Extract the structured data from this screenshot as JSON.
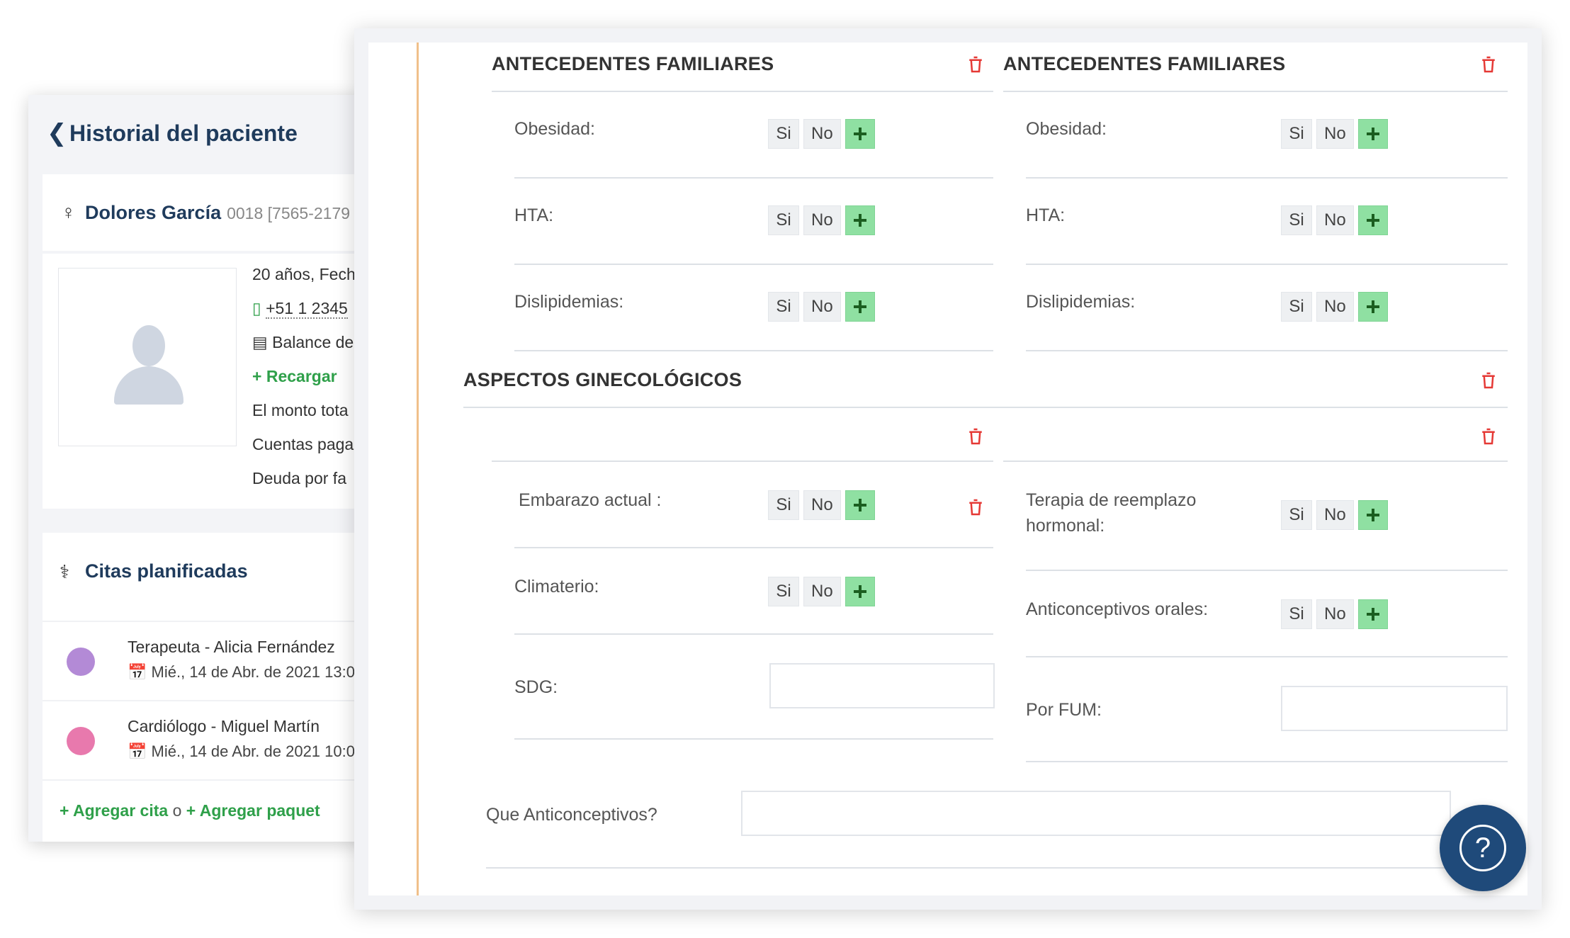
{
  "history": {
    "back_icon": "chevron-left-icon",
    "title": "Historial del paciente",
    "patient_name": "Dolores García",
    "patient_id": "0018 [7565-2179",
    "info": {
      "age_line": "20 años, Fech",
      "phone": "+51 1 2345",
      "balance": "Balance de",
      "recharge": "Recargar",
      "total": "El monto tota",
      "paid": "Cuentas paga",
      "debt": "Deuda por fa"
    },
    "citas_title": "Citas planificadas",
    "citas": [
      {
        "name": "Terapeuta - Alicia Fernández",
        "date": "Mié., 14 de Abr. de 2021 13:0",
        "color": "#b38ad6"
      },
      {
        "name": "Cardiólogo - Miguel Martín",
        "date": "Mié., 14 de Abr. de 2021 10:0",
        "color": "#e879ad"
      }
    ],
    "add_cita": "Agregar cita",
    "connector": "o",
    "add_paquete": "Agregar paquet"
  },
  "form": {
    "yes": "Si",
    "no": "No",
    "family_left_title": "ANTECEDENTES FAMILIARES",
    "family_right_title": "ANTECEDENTES FAMILIARES",
    "family_fields": [
      "Obesidad:",
      "HTA:",
      "Dislipidemias:"
    ],
    "gyn_title": "ASPECTOS GINECOLÓGICOS",
    "gyn_left": {
      "embarazo": "Embarazo actual :",
      "climaterio": "Climaterio:",
      "sdg": "SDG:"
    },
    "gyn_right": {
      "terapia_1": "Terapia de reemplazo",
      "terapia_2": "hormonal:",
      "anticonceptivos": "Anticonceptivos orales:",
      "fum": "Por FUM:"
    },
    "que_anticonceptivos": "Que Anticonceptivos?"
  },
  "help": {
    "symbol": "?"
  },
  "colors": {
    "accent": "#1f3b5c",
    "green": "#2fa04a",
    "delete": "#e53935",
    "help": "#1f4a7a"
  }
}
